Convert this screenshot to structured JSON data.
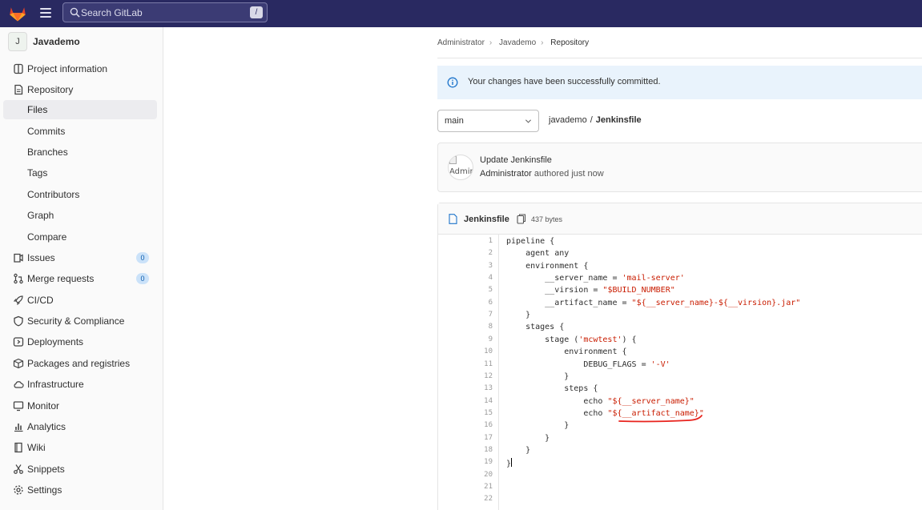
{
  "topbar": {
    "search_placeholder": "Search GitLab",
    "search_shortcut": "/"
  },
  "sidebar": {
    "project_avatar": "J",
    "project_name": "Javademo",
    "items": [
      {
        "label": "Project information",
        "icon": "project-icon"
      },
      {
        "label": "Repository",
        "icon": "document-icon"
      },
      {
        "label": "Files",
        "sub": true,
        "active": true
      },
      {
        "label": "Commits",
        "sub": true
      },
      {
        "label": "Branches",
        "sub": true
      },
      {
        "label": "Tags",
        "sub": true
      },
      {
        "label": "Contributors",
        "sub": true
      },
      {
        "label": "Graph",
        "sub": true
      },
      {
        "label": "Compare",
        "sub": true
      },
      {
        "label": "Issues",
        "icon": "issues-icon",
        "badge": "0"
      },
      {
        "label": "Merge requests",
        "icon": "merge-request-icon",
        "badge": "0"
      },
      {
        "label": "CI/CD",
        "icon": "rocket-icon"
      },
      {
        "label": "Security & Compliance",
        "icon": "shield-icon"
      },
      {
        "label": "Deployments",
        "icon": "deployments-icon"
      },
      {
        "label": "Packages and registries",
        "icon": "package-icon"
      },
      {
        "label": "Infrastructure",
        "icon": "cloud-icon"
      },
      {
        "label": "Monitor",
        "icon": "monitor-icon"
      },
      {
        "label": "Analytics",
        "icon": "chart-icon"
      },
      {
        "label": "Wiki",
        "icon": "book-icon"
      },
      {
        "label": "Snippets",
        "icon": "snippet-icon"
      },
      {
        "label": "Settings",
        "icon": "gear-icon"
      }
    ]
  },
  "breadcrumb": [
    "Administrator",
    "Javademo",
    "Repository"
  ],
  "alert": {
    "text": "Your changes have been successfully committed."
  },
  "branch": {
    "value": "main"
  },
  "path": {
    "dir": "javademo",
    "separator": "/",
    "file": "Jenkinsfile"
  },
  "commit": {
    "avatar_alt": "Admir",
    "title": "Update Jenkinsfile",
    "author": "Administrator",
    "meta": "authored just now"
  },
  "file": {
    "name": "Jenkinsfile",
    "size": "437 bytes",
    "line_numbers": [
      "1",
      "2",
      "3",
      "4",
      "5",
      "6",
      "7",
      "8",
      "9",
      "10",
      "11",
      "12",
      "13",
      "14",
      "15",
      "16",
      "17",
      "18",
      "19",
      "20",
      "21",
      "22"
    ],
    "lines": [
      [
        {
          "t": "pipeline {"
        }
      ],
      [
        {
          "t": "    agent any"
        }
      ],
      [
        {
          "t": "    environment {"
        }
      ],
      [
        {
          "t": "        __server_name = "
        },
        {
          "t": "'mail-server'",
          "s": true
        }
      ],
      [
        {
          "t": "        __virsion = "
        },
        {
          "t": "\"$BUILD_NUMBER\"",
          "s": true
        }
      ],
      [
        {
          "t": "        __artifact_name = "
        },
        {
          "t": "\"${__server_name}-${__virsion}.jar\"",
          "s": true
        }
      ],
      [
        {
          "t": "    }"
        }
      ],
      [
        {
          "t": "    stages {"
        }
      ],
      [
        {
          "t": "        stage ("
        },
        {
          "t": "'mcwtest'",
          "s": true
        },
        {
          "t": ") {"
        }
      ],
      [
        {
          "t": "            environment {"
        }
      ],
      [
        {
          "t": "                DEBUG_FLAGS = "
        },
        {
          "t": "'-V'",
          "s": true
        }
      ],
      [
        {
          "t": "            }"
        }
      ],
      [
        {
          "t": "            steps {"
        }
      ],
      [
        {
          "t": "                echo "
        },
        {
          "t": "\"${__server_name}\"",
          "s": true
        }
      ],
      [
        {
          "t": "                echo "
        },
        {
          "t": "\"${__artifact_name}\"",
          "s": true
        }
      ],
      [
        {
          "t": "            }"
        }
      ],
      [
        {
          "t": "        }"
        }
      ],
      [
        {
          "t": "    }"
        }
      ],
      [
        {
          "t": "}"
        }
      ],
      [],
      [],
      []
    ],
    "cursor_line": 19
  },
  "colors": {
    "topbar": "#292961",
    "string": "#c91c00",
    "annotation": "#e8231d",
    "alert_bg": "#e9f3fc",
    "badge_bg": "#cbe2f9"
  }
}
